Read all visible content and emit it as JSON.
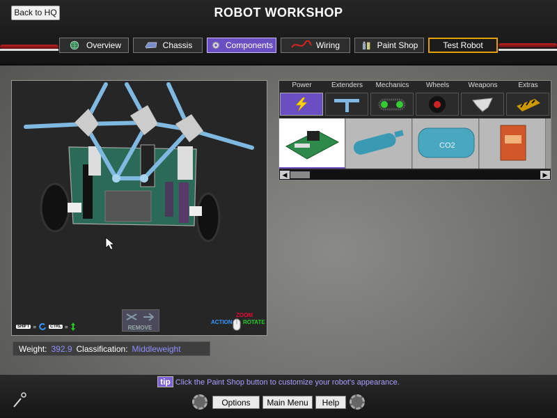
{
  "header": {
    "title": "ROBOT WORKSHOP",
    "back_label": "Back to HQ",
    "tabs": [
      {
        "label": "Overview",
        "icon": "globe-icon"
      },
      {
        "label": "Chassis",
        "icon": "chassis-icon"
      },
      {
        "label": "Components",
        "icon": "gear-icon",
        "active": true
      },
      {
        "label": "Wiring",
        "icon": "wire-icon"
      },
      {
        "label": "Paint Shop",
        "icon": "paint-icon"
      },
      {
        "label": "Test Robot",
        "icon": ""
      }
    ]
  },
  "viewport": {
    "remove_label": "REMOVE",
    "shift_key": "SHIFT",
    "ctrl_key": "CTRL",
    "legend_action": "ACTION",
    "legend_zoom": "ZOOM",
    "legend_rotate": "ROTATE"
  },
  "stats": {
    "weight_label": "Weight:",
    "weight_value": "392.9",
    "class_label": "Classification:",
    "class_value": "Middleweight"
  },
  "components": {
    "categories": [
      "Power",
      "Extenders",
      "Mechanics",
      "Wheels",
      "Weapons",
      "Extras"
    ],
    "active_category": "Power",
    "items": [
      "circuit-board",
      "blue-tank",
      "co2-tank",
      "orange-battery"
    ]
  },
  "footer": {
    "tip_badge": "tip",
    "tip_text": "Click the Paint Shop button to customize your robot's appearance.",
    "buttons": {
      "options": "Options",
      "main_menu": "Main Menu",
      "help": "Help"
    }
  },
  "colors": {
    "accent": "#6a4fc2",
    "stat_value": "#8f8fff",
    "hazard": "#e0a000"
  }
}
